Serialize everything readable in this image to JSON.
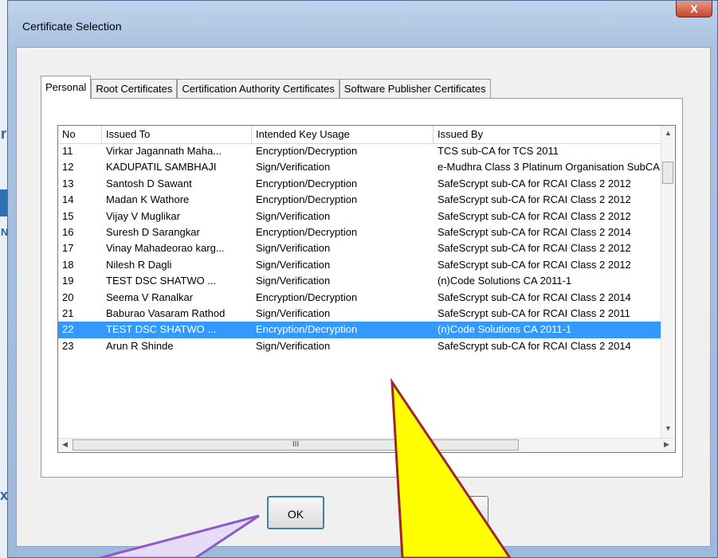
{
  "dialog": {
    "title": "Certificate Selection",
    "close_glyph": "X",
    "tabs": [
      {
        "label": "Personal"
      },
      {
        "label": "Root Certificates"
      },
      {
        "label": "Certification Authority Certificates"
      },
      {
        "label": "Software Publisher Certificates"
      }
    ],
    "columns": [
      "No",
      "Issued To",
      "Intended Key Usage",
      "Issued By"
    ],
    "rows": [
      [
        "11",
        "Virkar Jagannath Maha...",
        "Encryption/Decryption",
        "TCS sub-CA for TCS 2011"
      ],
      [
        "12",
        "KADUPATIL SAMBHAJI",
        "Sign/Verification",
        "e-Mudhra Class 3 Platinum Organisation SubCA"
      ],
      [
        "13",
        "Santosh D Sawant",
        "Encryption/Decryption",
        "SafeScrypt sub-CA for RCAI Class 2 2012"
      ],
      [
        "14",
        "Madan K Wathore",
        "Encryption/Decryption",
        "SafeScrypt sub-CA for RCAI Class 2 2012"
      ],
      [
        "15",
        "Vijay V Muglikar",
        "Sign/Verification",
        "SafeScrypt sub-CA for RCAI Class 2 2012"
      ],
      [
        "16",
        "Suresh D Sarangkar",
        "Encryption/Decryption",
        "SafeScrypt sub-CA for RCAI Class 2 2014"
      ],
      [
        "17",
        "Vinay Mahadeorao karg...",
        "Sign/Verification",
        "SafeScrypt sub-CA for RCAI Class 2 2012"
      ],
      [
        "18",
        "Nilesh R Dagli",
        "Sign/Verification",
        "SafeScrypt sub-CA for RCAI Class 2 2012"
      ],
      [
        "19",
        "TEST DSC SHATWO ...",
        "Sign/Verification",
        "(n)Code Solutions CA 2011-1"
      ],
      [
        "20",
        "Seema V Ranalkar",
        "Encryption/Decryption",
        "SafeScrypt sub-CA for RCAI Class 2 2014"
      ],
      [
        "21",
        "Baburao Vasaram Rathod",
        "Sign/Verification",
        "SafeScrypt sub-CA for RCAI Class 2 2011"
      ],
      [
        "22",
        "TEST DSC SHATWO ...",
        "Encryption/Decryption",
        "(n)Code Solutions CA 2011-1"
      ],
      [
        "23",
        "Arun R Shinde",
        "Sign/Verification",
        "SafeScrypt sub-CA for RCAI Class 2 2014"
      ]
    ],
    "selected_row": "22",
    "hscroll_grip": "III",
    "ok_label": "OK",
    "cancel_label": ""
  },
  "annotations": {
    "yellow_callout_color": "#ffff00",
    "callout_border_color": "#a0262e",
    "purple_pointer_color": "#8b5cc6",
    "purple_fill_color": "#e6dcf7"
  },
  "background": {
    "left_fragment_1": "r",
    "left_fragment_2": "N",
    "left_fragment_3": "x"
  }
}
